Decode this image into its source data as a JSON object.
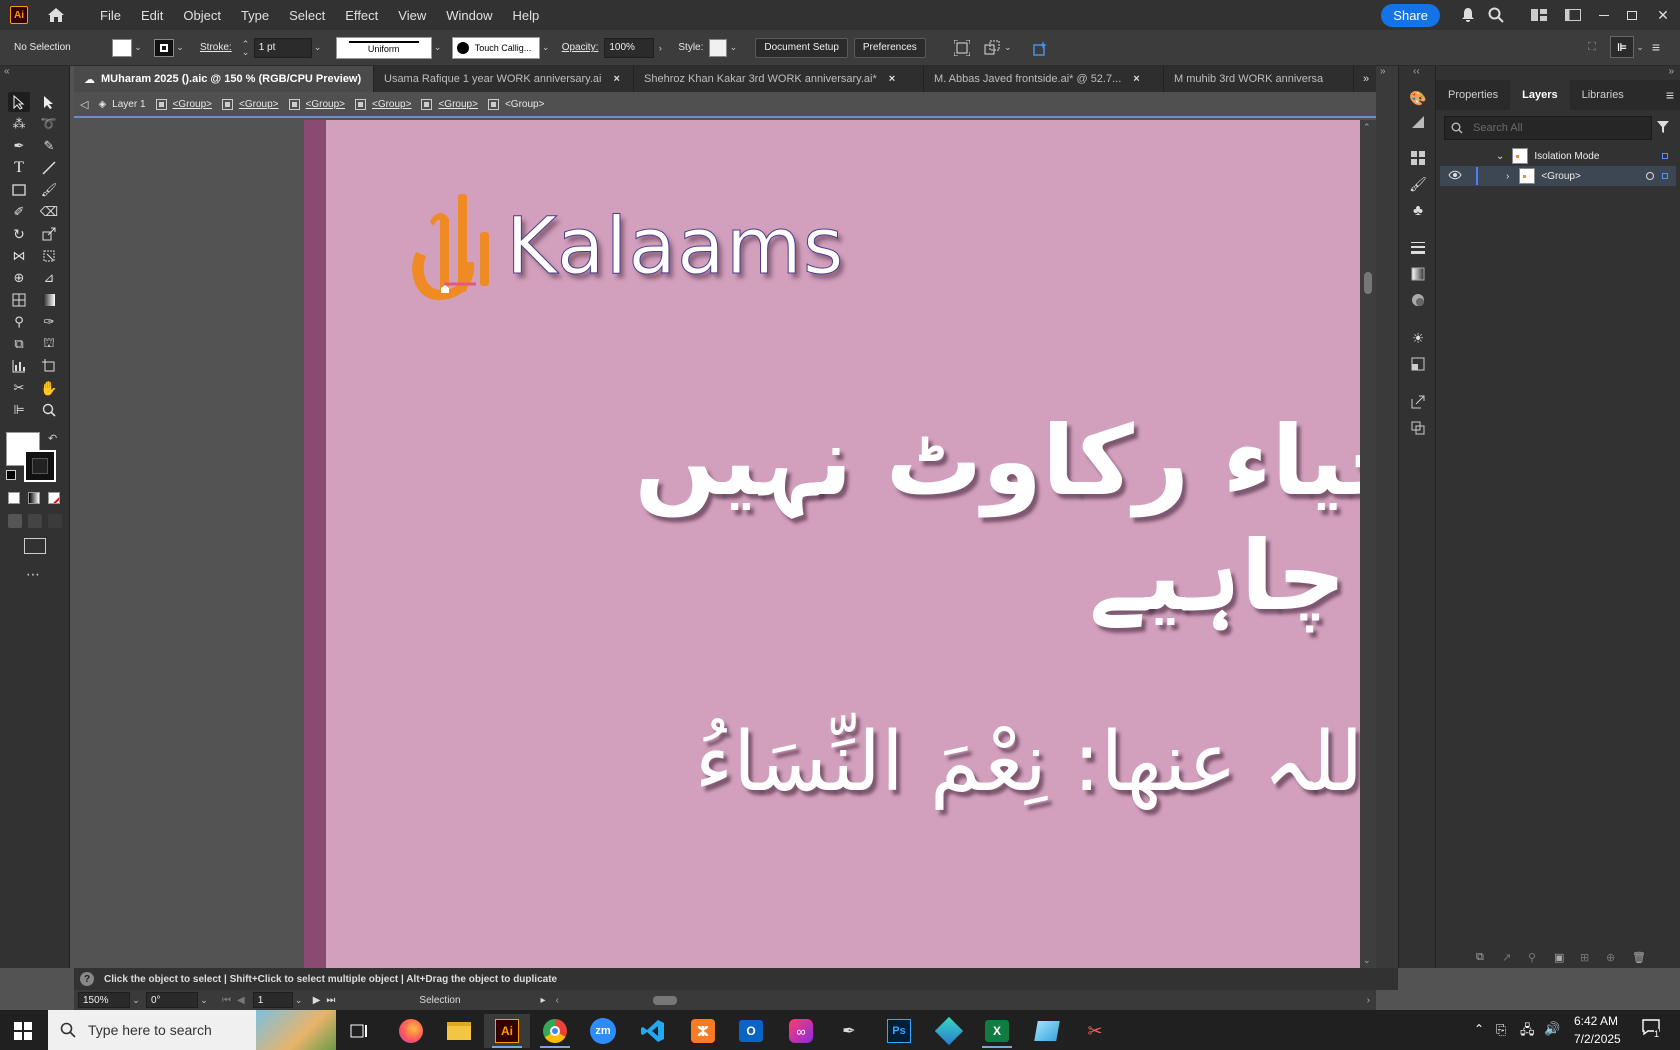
{
  "menubar": {
    "items": [
      "File",
      "Edit",
      "Object",
      "Type",
      "Select",
      "Effect",
      "View",
      "Window",
      "Help"
    ],
    "share_label": "Share"
  },
  "control": {
    "selection": "No Selection",
    "stroke_label": "Stroke:",
    "stroke_value": "1 pt",
    "profile": "Uniform",
    "brush": "Touch Callig...",
    "opacity_label": "Opacity:",
    "opacity_value": "100%",
    "style_label": "Style:",
    "doc_setup": "Document Setup",
    "preferences": "Preferences"
  },
  "tabs": [
    {
      "label": "MUharam 2025 ().aic @ 150 % (RGB/CPU Preview)",
      "active": true
    },
    {
      "label": "Usama Rafique 1 year WORK anniversary.ai",
      "active": false
    },
    {
      "label": "Shehroz Khan Kakar   3rd  WORK anniversary.ai*",
      "active": false
    },
    {
      "label": "M. Abbas Javed  frontside.ai* @ 52.7...",
      "active": false
    },
    {
      "label": "M muhib 3rd  WORK anniversa",
      "active": false
    }
  ],
  "breadcrumb": {
    "layer": "Layer 1",
    "groups": [
      "<Group>",
      "<Group>",
      "<Group>",
      "<Group>",
      "<Group>",
      "<Group>"
    ]
  },
  "artwork": {
    "logo_text": "Kalaams",
    "line1": "حیاء رکاوٹ نہیں",
    "line2": "چاہیے",
    "line3": "اللہ عنھا: نِعْمَ النِّسَاءُ"
  },
  "panel": {
    "tabs": [
      "Properties",
      "Layers",
      "Libraries"
    ],
    "active_tab": "Layers",
    "search_placeholder": "Search All",
    "isolation_label": "Isolation Mode",
    "group_label": "<Group>"
  },
  "status": {
    "hint": "Click the object to select  |  Shift+Click to select multiple object  |  Alt+Drag the object to duplicate",
    "zoom": "150%",
    "rotation": "0°",
    "artboard_num": "1",
    "tool": "Selection"
  },
  "taskbar": {
    "search_placeholder": "Type here to search",
    "time": "6:42 AM",
    "date": "7/2/2025",
    "notif_count": "1"
  },
  "colors": {
    "artboard": "#d29fbd",
    "accent": "#1473e6",
    "logo_orange": "#f08a24"
  }
}
